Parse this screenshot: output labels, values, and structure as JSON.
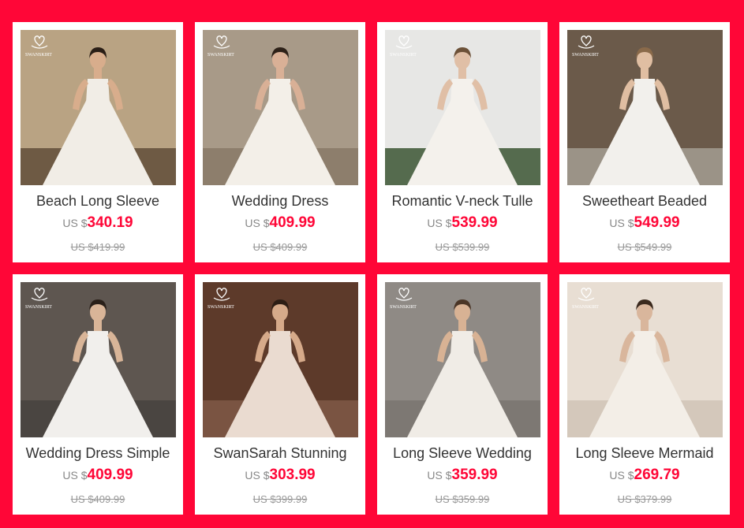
{
  "brand_logo_text": "SWANSKIRT",
  "currency_prefix": "US $",
  "products": [
    {
      "title": "Beach Long Sleeve",
      "price": "340.19",
      "original_price": "US $419.99",
      "bg": "#b9a383",
      "dress": "#f1ede6",
      "skin": "#d8ad8c",
      "hair": "#2a1e16",
      "floor": "#6e5a44"
    },
    {
      "title": "Wedding Dress",
      "price": "409.99",
      "original_price": "US $409.99",
      "bg": "#a89a88",
      "dress": "#f3efe8",
      "skin": "#d9b096",
      "hair": "#2d2118",
      "floor": "#8d7e6c"
    },
    {
      "title": "Romantic V-neck Tulle",
      "price": "539.99",
      "original_price": "US $539.99",
      "bg": "#e7e7e5",
      "dress": "#f4f1ec",
      "skin": "#e0bfa6",
      "hair": "#6c5138",
      "floor": "#556b4e"
    },
    {
      "title": "Sweetheart Beaded",
      "price": "549.99",
      "original_price": "US $549.99",
      "bg": "#6b5a4a",
      "dress": "#f2f0ec",
      "skin": "#e0bea2",
      "hair": "#8a6a4a",
      "floor": "#9b9387"
    },
    {
      "title": "Wedding Dress Simple",
      "price": "409.99",
      "original_price": "US $409.99",
      "bg": "#5e5650",
      "dress": "#f1efec",
      "skin": "#d9b598",
      "hair": "#2a2019",
      "floor": "#4a4541"
    },
    {
      "title": "SwanSarah Stunning",
      "price": "303.99",
      "original_price": "US $399.99",
      "bg": "#5d3a2a",
      "dress": "#eadbd0",
      "skin": "#d6aa8a",
      "hair": "#2c1d14",
      "floor": "#7a5442"
    },
    {
      "title": "Long Sleeve Wedding",
      "price": "359.99",
      "original_price": "US $359.99",
      "bg": "#8f8a85",
      "dress": "#f0ece6",
      "skin": "#d8b294",
      "hair": "#4a3526",
      "floor": "#7d7873"
    },
    {
      "title": "Long Sleeve Mermaid",
      "price": "269.79",
      "original_price": "US $379.99",
      "bg": "#e8ded3",
      "dress": "#f3eee7",
      "skin": "#d9b69c",
      "hair": "#3a291d",
      "floor": "#d4c8bb"
    }
  ]
}
